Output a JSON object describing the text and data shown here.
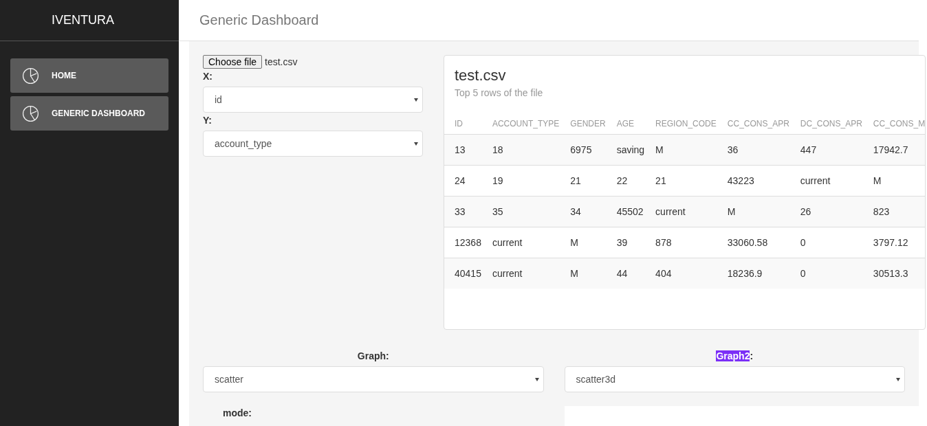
{
  "sidebar": {
    "brand": "IVENTURA",
    "items": [
      {
        "label": "HOME",
        "selected": false
      },
      {
        "label": "GENERIC DASHBOARD",
        "selected": false
      }
    ]
  },
  "header": {
    "title": "Generic Dashboard"
  },
  "file_input": {
    "button": "Choose file",
    "filename": "test.csv"
  },
  "x_select": {
    "label": "X:",
    "value": "id"
  },
  "y_select": {
    "label": "Y:",
    "value": "account_type"
  },
  "preview": {
    "title": "test.csv",
    "subtitle": "Top 5 rows of the file",
    "columns": [
      "ID",
      "ACCOUNT_TYPE",
      "GENDER",
      "AGE",
      "REGION_CODE",
      "CC_CONS_APR",
      "DC_CONS_APR",
      "CC_CONS_M"
    ],
    "rows": [
      [
        "13",
        "18",
        "6975",
        "saving",
        "M",
        "36",
        "447",
        "17942.7"
      ],
      [
        "24",
        "19",
        "21",
        "22",
        "21",
        "43223",
        "current",
        "M"
      ],
      [
        "33",
        "35",
        "34",
        "45502",
        "current",
        "M",
        "26",
        "823"
      ],
      [
        "12368",
        "current",
        "M",
        "39",
        "878",
        "33060.58",
        "0",
        "3797.12"
      ],
      [
        "40415",
        "current",
        "M",
        "44",
        "404",
        "18236.9",
        "0",
        "30513.3"
      ]
    ]
  },
  "graph_select": {
    "label": "Graph",
    "suffix": ":",
    "highlighted": false,
    "value": "scatter"
  },
  "graph2_select": {
    "label": "Graph2",
    "suffix": ":",
    "highlighted": true,
    "value": "scatter3d"
  },
  "mode": {
    "label": "mode:"
  }
}
